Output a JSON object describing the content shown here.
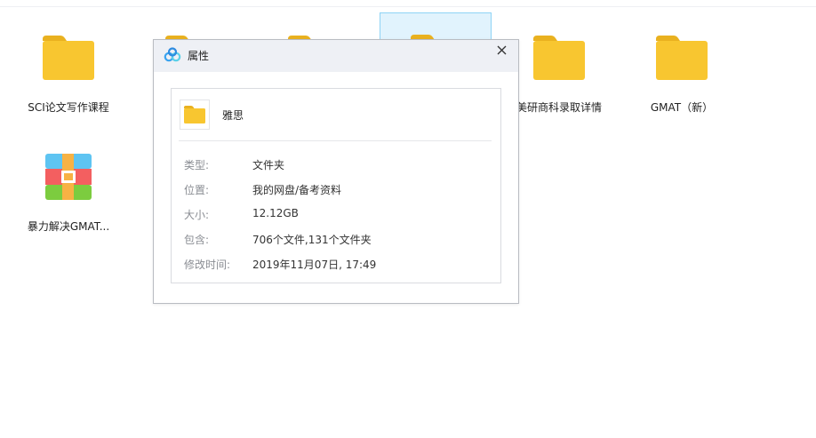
{
  "files": [
    {
      "name": "SCI论文写作课程",
      "type": "folder"
    },
    {
      "name": "",
      "type": "folder"
    },
    {
      "name": "",
      "type": "folder"
    },
    {
      "name": "",
      "type": "folder",
      "selected": true
    },
    {
      "name": "美研商科录取详情",
      "type": "folder"
    },
    {
      "name": "GMAT（新）",
      "type": "folder"
    },
    {
      "name": "暴力解决GMAT...",
      "type": "archive"
    }
  ],
  "dialog": {
    "title": "属性",
    "close_icon": "close-icon",
    "logo_icon": "baidu-netdisk-logo-icon",
    "item_name": "雅思",
    "properties": [
      {
        "key": "类型:",
        "value": "文件夹"
      },
      {
        "key": "位置:",
        "value": "我的网盘/备考资料"
      },
      {
        "key": "大小:",
        "value": "12.12GB"
      },
      {
        "key": "包含:",
        "value": "706个文件,131个文件夹"
      },
      {
        "key": "修改时间:",
        "value": "2019年11月07日, 17:49"
      }
    ]
  },
  "colors": {
    "folder": "#f8c630",
    "folder_tab": "#e9b11f",
    "selection_bg": "#e1f3fd",
    "selection_border": "#8ed3f5",
    "dialog_titlebar": "#eef0f5"
  }
}
